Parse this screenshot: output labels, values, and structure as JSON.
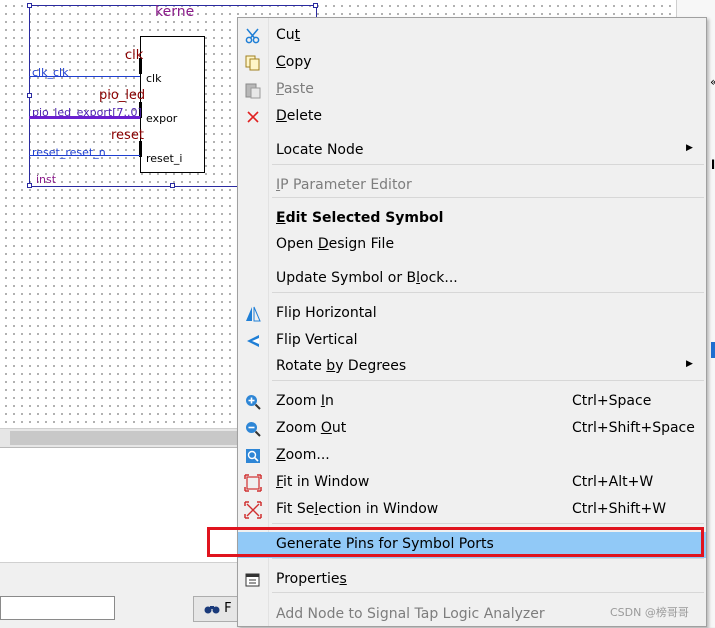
{
  "schematic": {
    "symbol_title": "kerne",
    "port_clk": "clk",
    "port_export": "expor",
    "port_reset": "reset_i",
    "sig_clk": "clk",
    "sig_pio": "pio_led",
    "sig_reset": "reset",
    "net_clk": "clk_clk",
    "net_pio": "pio_led_export[7..0]",
    "net_reset": "reset_reset_n",
    "instance": "inst",
    "find_button_fragment": "F"
  },
  "menu": {
    "items": [
      {
        "label": "Cut",
        "icon": "scissors-icon",
        "shortcut": "",
        "disabled": false,
        "bold": false
      },
      {
        "label": "Copy",
        "icon": "copy-icon",
        "shortcut": "",
        "disabled": false,
        "bold": false
      },
      {
        "label": "Paste",
        "icon": "paste-icon",
        "shortcut": "",
        "disabled": true,
        "bold": false
      },
      {
        "label": "Delete",
        "icon": "delete-x-icon",
        "shortcut": "",
        "disabled": false,
        "bold": false
      },
      {
        "label": "Locate Node",
        "icon": "",
        "shortcut": "",
        "disabled": false,
        "bold": false,
        "submenu": true
      },
      {
        "label": "IP Parameter Editor",
        "icon": "",
        "shortcut": "",
        "disabled": true,
        "bold": false
      },
      {
        "label": "Edit Selected Symbol",
        "icon": "",
        "shortcut": "",
        "disabled": false,
        "bold": true
      },
      {
        "label": "Open Design File",
        "icon": "",
        "shortcut": "",
        "disabled": false,
        "bold": false
      },
      {
        "label": "Update Symbol or Block...",
        "icon": "",
        "shortcut": "",
        "disabled": false,
        "bold": false
      },
      {
        "label": "Flip Horizontal",
        "icon": "flip-horizontal-icon",
        "shortcut": "",
        "disabled": false,
        "bold": false
      },
      {
        "label": "Flip Vertical",
        "icon": "flip-vertical-icon",
        "shortcut": "",
        "disabled": false,
        "bold": false
      },
      {
        "label": "Rotate by Degrees",
        "icon": "",
        "shortcut": "",
        "disabled": false,
        "bold": false,
        "submenu": true
      },
      {
        "label": "Zoom In",
        "icon": "zoom-in-icon",
        "shortcut": "Ctrl+Space",
        "disabled": false,
        "bold": false
      },
      {
        "label": "Zoom Out",
        "icon": "zoom-out-icon",
        "shortcut": "Ctrl+Shift+Space",
        "disabled": false,
        "bold": false
      },
      {
        "label": "Zoom...",
        "icon": "zoom-icon",
        "shortcut": "",
        "disabled": false,
        "bold": false
      },
      {
        "label": "Fit in Window",
        "icon": "fit-window-icon",
        "shortcut": "Ctrl+Alt+W",
        "disabled": false,
        "bold": false
      },
      {
        "label": "Fit Selection in Window",
        "icon": "fit-selection-icon",
        "shortcut": "Ctrl+Shift+W",
        "disabled": false,
        "bold": false
      },
      {
        "label": "Generate Pins for Symbol Ports",
        "icon": "",
        "shortcut": "",
        "disabled": false,
        "bold": false,
        "highlighted": true
      },
      {
        "label": "Properties",
        "icon": "properties-icon",
        "shortcut": "",
        "disabled": false,
        "bold": false
      },
      {
        "label": "Add Node to Signal Tap Logic Analyzer",
        "icon": "",
        "shortcut": "",
        "disabled": true,
        "bold": false
      }
    ]
  },
  "watermark": "CSDN @榜哥哥",
  "colors": {
    "highlight": "#91c9f7",
    "callout_red": "#e0141e",
    "net_blue": "#1f3fd0",
    "bus_purple": "#6a1fd0"
  }
}
